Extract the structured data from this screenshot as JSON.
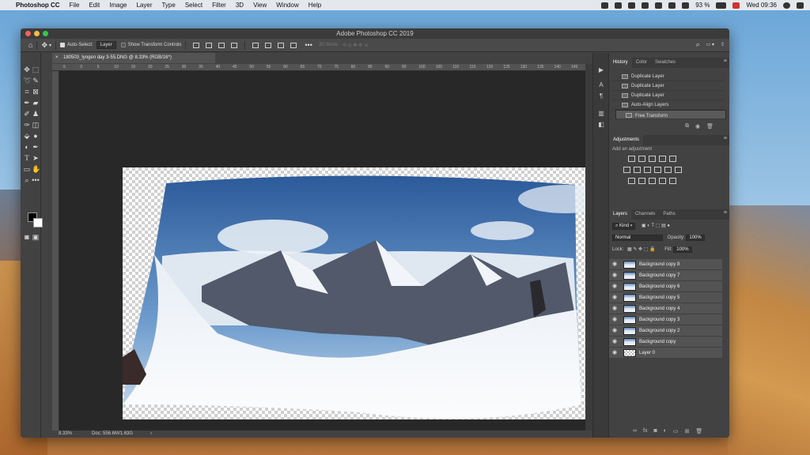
{
  "menubar": {
    "apple": "",
    "app": "Photoshop CC",
    "items": [
      "File",
      "Edit",
      "Image",
      "Layer",
      "Type",
      "Select",
      "Filter",
      "3D",
      "View",
      "Window",
      "Help"
    ],
    "battery": "93 %",
    "clock": "Wed 09:36"
  },
  "window": {
    "title": "Adobe Photoshop CC 2019"
  },
  "options": {
    "auto_select_label": "Auto-Select:",
    "auto_select_value": "Layer",
    "show_transform_label": "Show Transform Controls",
    "mode_3d": "3D Mode:"
  },
  "document": {
    "tab_title": "180503_lyngen day 3-55.DNG @ 8.33% (RGB/16*)",
    "zoom": "8.33%",
    "doc_info": "Doc: 556.6M/1.63G",
    "ruler_ticks": [
      "5",
      "0",
      "5",
      "10",
      "15",
      "20",
      "25",
      "30",
      "35",
      "40",
      "45",
      "50",
      "55",
      "60",
      "65",
      "70",
      "75",
      "80",
      "85",
      "90",
      "95",
      "100",
      "105",
      "110",
      "115",
      "120",
      "125",
      "130",
      "135",
      "140",
      "145"
    ]
  },
  "history": {
    "tabs": [
      "History",
      "Color",
      "Swatches"
    ],
    "rows": [
      {
        "label": "Duplicate Layer",
        "selected": false
      },
      {
        "label": "Duplicate Layer",
        "selected": false
      },
      {
        "label": "Duplicate Layer",
        "selected": false
      },
      {
        "label": "Auto-Align Layers",
        "selected": false
      },
      {
        "label": "Free Transform",
        "selected": true
      }
    ]
  },
  "adjustments": {
    "title": "Adjustments",
    "subtitle": "Add an adjustment"
  },
  "layers": {
    "tabs": [
      "Layers",
      "Channels",
      "Paths"
    ],
    "filter": "Kind",
    "blend_mode": "Normal",
    "opacity_label": "Opacity:",
    "opacity_value": "100%",
    "lock_label": "Lock:",
    "fill_label": "Fill:",
    "fill_value": "100%",
    "rows": [
      {
        "name": "Background copy 8"
      },
      {
        "name": "Background copy 7"
      },
      {
        "name": "Background copy 6"
      },
      {
        "name": "Background copy 5"
      },
      {
        "name": "Background copy 4"
      },
      {
        "name": "Background copy 3"
      },
      {
        "name": "Background copy 2"
      },
      {
        "name": "Background copy"
      },
      {
        "name": "Layer 0"
      }
    ]
  },
  "colors": {
    "panel_bg": "#424242",
    "canvas_bg": "#282828",
    "selected_row": "#5a5a5a"
  }
}
